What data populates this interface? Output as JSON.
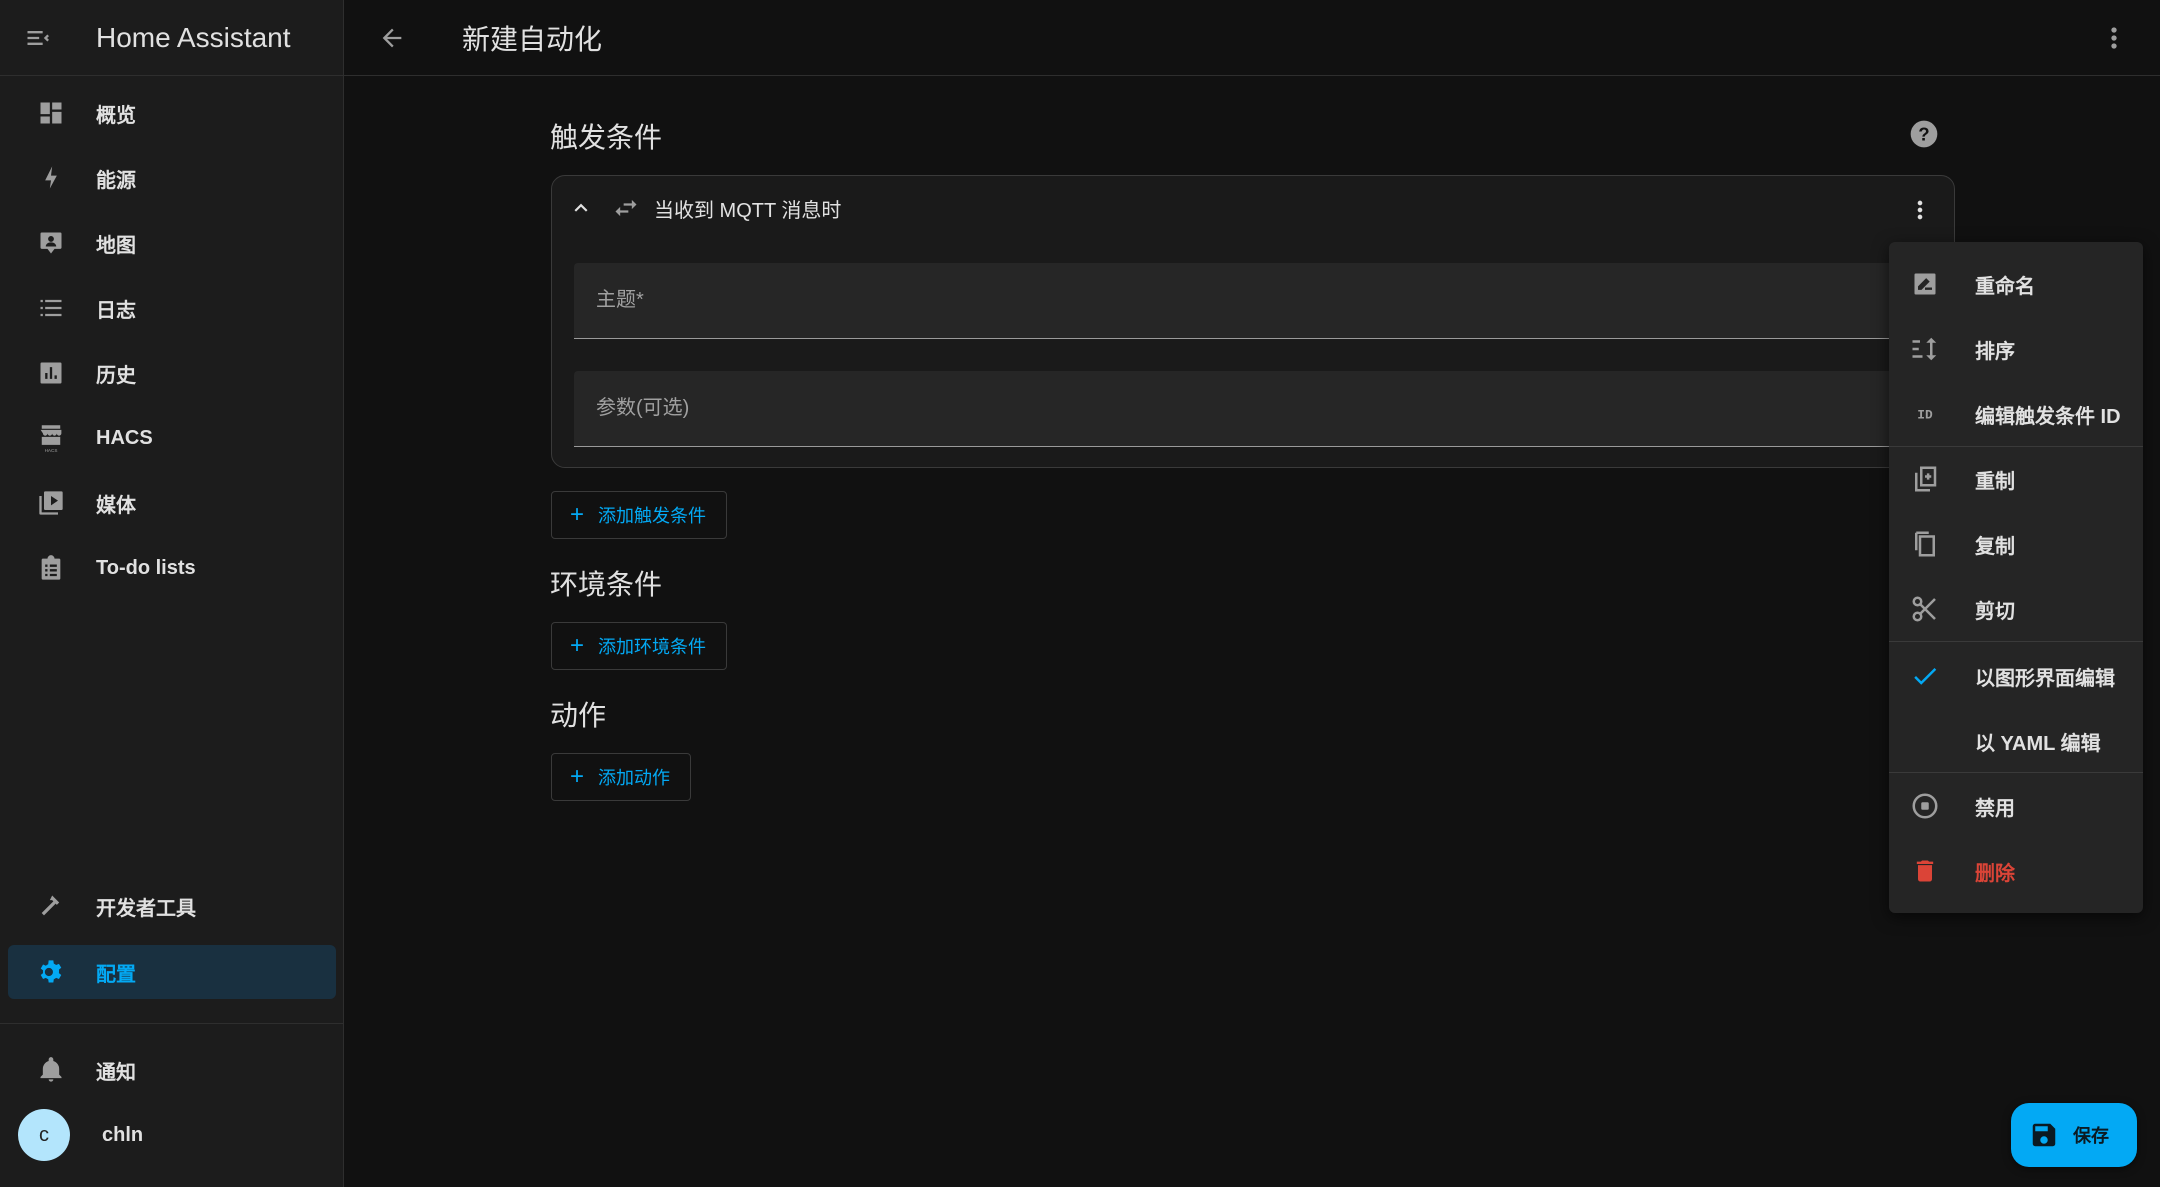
{
  "app": {
    "title": "Home Assistant"
  },
  "sidebar": {
    "items": [
      {
        "label": "概览",
        "icon": "dashboard-icon"
      },
      {
        "label": "能源",
        "icon": "lightning-bolt-icon"
      },
      {
        "label": "地图",
        "icon": "map-account-icon"
      },
      {
        "label": "日志",
        "icon": "list-icon"
      },
      {
        "label": "历史",
        "icon": "chart-box-icon"
      },
      {
        "label": "HACS",
        "icon": "hacs-store-icon"
      },
      {
        "label": "媒体",
        "icon": "play-box-multiple-icon"
      },
      {
        "label": "To-do lists",
        "icon": "clipboard-list-icon"
      }
    ],
    "bottom_items": [
      {
        "label": "开发者工具",
        "icon": "hammer-icon"
      },
      {
        "label": "配置",
        "icon": "gear-icon",
        "active": true
      }
    ],
    "notifications": {
      "label": "通知",
      "icon": "bell-icon"
    },
    "user": {
      "initial": "c",
      "name": "chln"
    }
  },
  "topbar": {
    "title": "新建自动化"
  },
  "sections": {
    "triggers": {
      "title": "触发条件",
      "card": {
        "title": "当收到 MQTT 消息时",
        "topic": {
          "placeholder": "主题*",
          "value": ""
        },
        "payload": {
          "placeholder": "参数(可选)",
          "value": ""
        }
      },
      "add_label": "添加触发条件"
    },
    "conditions": {
      "title": "环境条件",
      "add_label": "添加环境条件"
    },
    "actions": {
      "title": "动作",
      "add_label": "添加动作"
    }
  },
  "menu": {
    "items": [
      {
        "label": "重命名",
        "icon": "rename-icon"
      },
      {
        "label": "排序",
        "icon": "sort-icon"
      },
      {
        "label": "编辑触发条件 ID",
        "icon": "id-icon"
      },
      {
        "label": "重制",
        "icon": "duplicate-icon"
      },
      {
        "label": "复制",
        "icon": "copy-icon"
      },
      {
        "label": "剪切",
        "icon": "scissors-icon"
      },
      {
        "label": "以图形界面编辑",
        "icon": "check-icon",
        "checked": true
      },
      {
        "label": "以 YAML 编辑",
        "icon": ""
      },
      {
        "label": "禁用",
        "icon": "stop-circle-icon"
      },
      {
        "label": "删除",
        "icon": "delete-icon",
        "danger": true
      }
    ]
  },
  "fab": {
    "label": "保存",
    "icon": "floppy-icon"
  },
  "colors": {
    "accent": "#03a9f4",
    "danger": "#db4437",
    "background": "#111111",
    "sidebar": "#1c1c1c"
  }
}
